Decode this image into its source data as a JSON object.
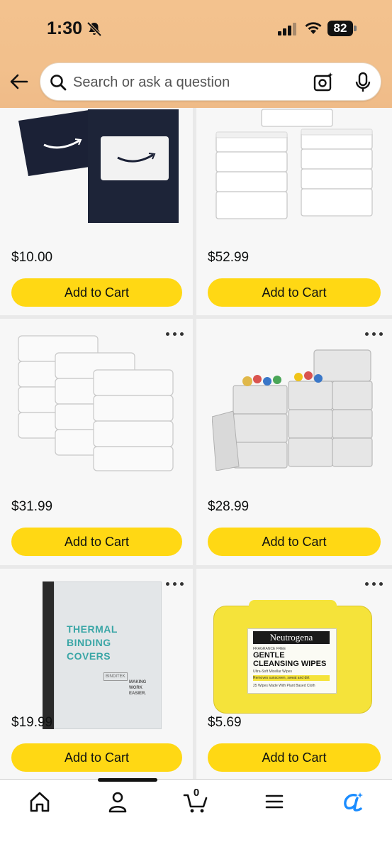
{
  "status_bar": {
    "time": "1:30",
    "battery": "82"
  },
  "search": {
    "placeholder": "Search or ask a question"
  },
  "products": [
    {
      "price": "$10.00",
      "button": "Add to Cart",
      "image": "amazon-gift-cards",
      "menu": false
    },
    {
      "price": "$52.99",
      "button": "Add to Cart",
      "image": "clear-storage-bins-stacked",
      "menu": false
    },
    {
      "price": "$31.99",
      "button": "Add to Cart",
      "image": "clear-storage-boxes-12-pack",
      "menu": true
    },
    {
      "price": "$28.99",
      "button": "Add to Cart",
      "image": "white-woven-storage-baskets",
      "menu": true
    },
    {
      "price": "$19.99",
      "button": "Add to Cart",
      "image": "thermal-binding-covers",
      "menu": true,
      "image_text": {
        "line1": "THERMAL",
        "line2": "BINDING",
        "line3": "COVERS",
        "brand": "BINDITEK",
        "tagline1": "MAKING",
        "tagline2": "WORK",
        "tagline3": "EASIER."
      }
    },
    {
      "price": "$5.69",
      "button": "Add to Cart",
      "image": "neutrogena-cleansing-wipes",
      "menu": true,
      "image_text": {
        "brand": "Neutrogena",
        "sub": "FRAGRANCE FREE",
        "line1": "GENTLE",
        "line2": "CLEANSING WIPES",
        "line3": "Ultra-Soft Micellar Wipes",
        "badge": "Removes sunscreen, sweat and dirt",
        "count": "25 Wipes Made With Plant Based Cloth"
      }
    }
  ],
  "bottom_nav": {
    "items": [
      "home-icon",
      "account-icon",
      "cart-icon",
      "menu-icon",
      "rufus-icon"
    ],
    "cart_count": "0"
  },
  "colors": {
    "header": "#f3c28e",
    "add_button": "#ffd814",
    "rufus": "#1a8cff"
  }
}
